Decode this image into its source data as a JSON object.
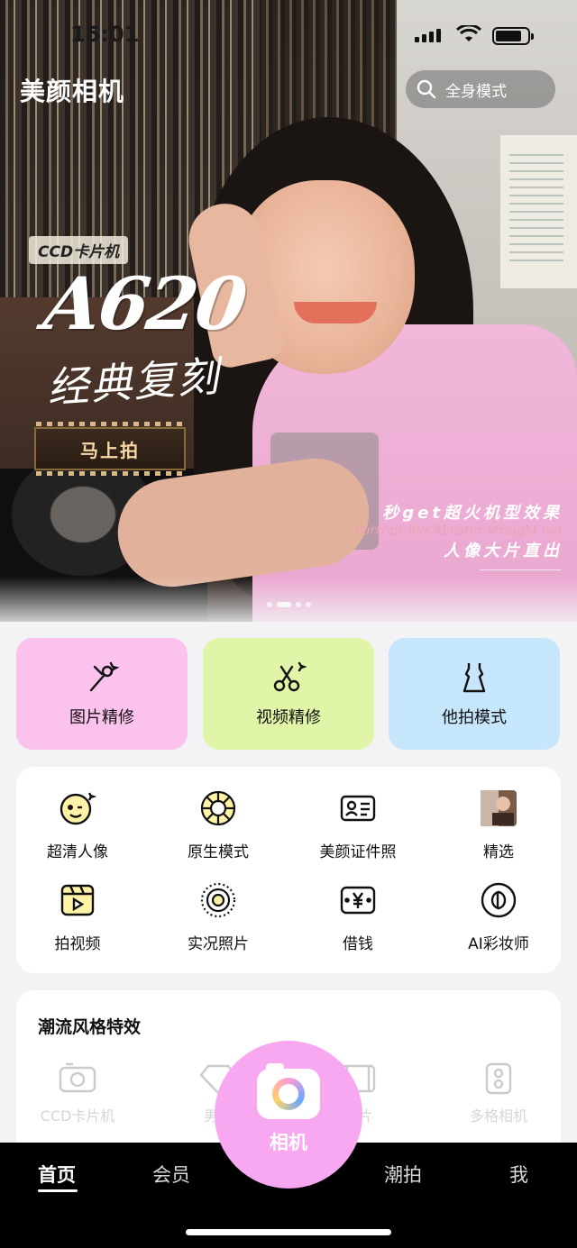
{
  "status_bar": {
    "time": "15:01"
  },
  "header": {
    "app_title": "美颜相机",
    "search_label": "全身模式"
  },
  "banner": {
    "tag": "CCD卡片机",
    "model": "A620",
    "subtitle": "经典复刻",
    "cta_label": "马上拍",
    "slogan_line1": "秒get超火机型效果",
    "slogan_line2": "Portrait blockbuster straight out",
    "slogan_line3": "人像大片直出",
    "page_count": 4,
    "active_page": 2
  },
  "feature_cards": [
    {
      "label": "图片精修",
      "icon": "magic-wand-icon",
      "color": "#fbc2ee"
    },
    {
      "label": "视频精修",
      "icon": "scissors-icon",
      "color": "#e1f5a8"
    },
    {
      "label": "他拍模式",
      "icon": "dress-icon",
      "color": "#c6e6fb"
    }
  ],
  "tools": [
    {
      "label": "超清人像",
      "icon": "face-icon"
    },
    {
      "label": "原生模式",
      "icon": "aperture-icon"
    },
    {
      "label": "美颜证件照",
      "icon": "id-card-icon"
    },
    {
      "label": "精选",
      "icon": "photo-thumbnail-icon"
    },
    {
      "label": "拍视频",
      "icon": "video-clapper-icon"
    },
    {
      "label": "实况照片",
      "icon": "live-photo-icon"
    },
    {
      "label": "借钱",
      "icon": "yen-icon"
    },
    {
      "label": "AI彩妆师",
      "icon": "makeup-brand-icon"
    }
  ],
  "trend": {
    "title": "潮流风格特效",
    "items": [
      {
        "label": "CCD卡片机",
        "icon": "ccd-camera-icon"
      },
      {
        "label": "男生",
        "icon": "diamond-icon"
      },
      {
        "label": "大片",
        "icon": "film-icon"
      },
      {
        "label": "多格相机",
        "icon": "multi-camera-icon"
      }
    ]
  },
  "bottom_nav": {
    "items": [
      {
        "label": "首页"
      },
      {
        "label": "会员"
      },
      {
        "label": "潮拍"
      },
      {
        "label": "我"
      }
    ],
    "camera_label": "相机"
  },
  "colors": {
    "camera_button": "#f7a8f0",
    "nav_background": "#000000",
    "page_background": "#f3f3f5"
  }
}
